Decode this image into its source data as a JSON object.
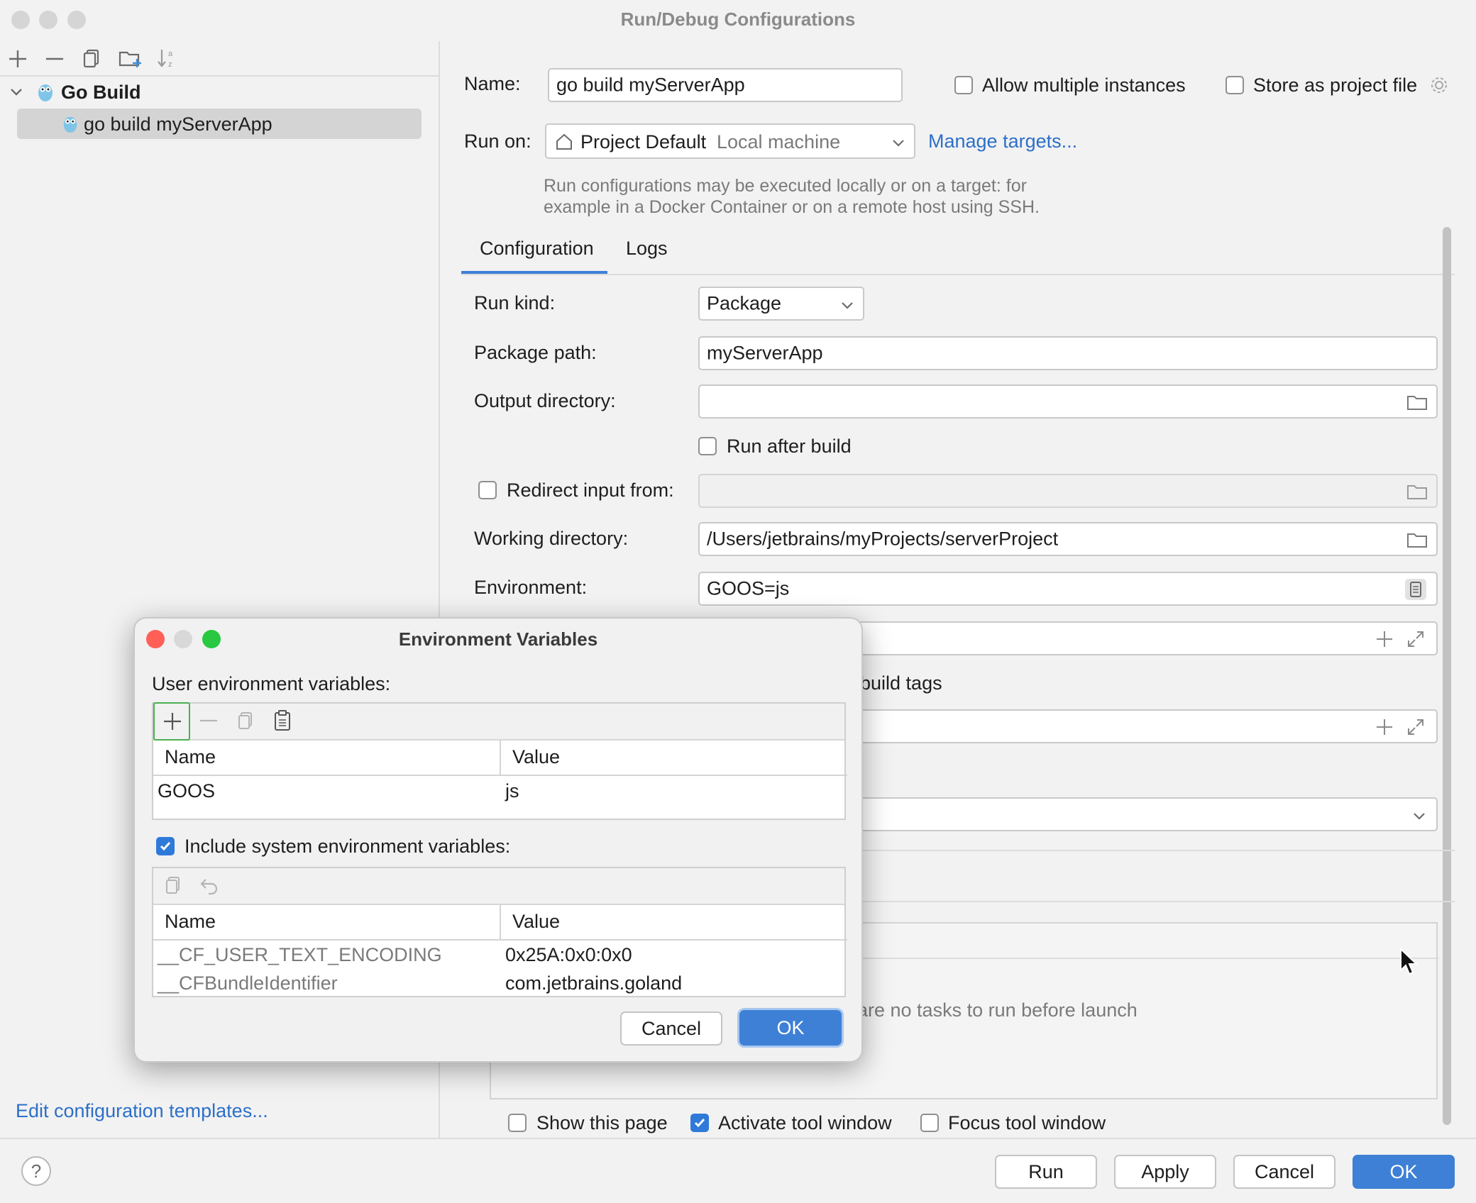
{
  "window": {
    "title": "Run/Debug Configurations"
  },
  "sidebar": {
    "tree": {
      "group_label": "Go Build",
      "item_label": "go build myServerApp"
    },
    "edit_templates_link": "Edit configuration templates..."
  },
  "form": {
    "name_label": "Name:",
    "name_value": "go build myServerApp",
    "allow_multiple_label": "Allow multiple instances",
    "store_project_label": "Store as project file",
    "run_on_label": "Run on:",
    "run_on_value": "Project Default",
    "run_on_hint": "Local machine",
    "manage_targets_link": "Manage targets...",
    "run_on_help_line1": "Run configurations may be executed locally or on a target: for",
    "run_on_help_line2": "example in a Docker Container or on a remote host using SSH.",
    "tabs": [
      {
        "label": "Configuration"
      },
      {
        "label": "Logs"
      }
    ],
    "run_kind_label": "Run kind:",
    "run_kind_value": "Package",
    "package_path_label": "Package path:",
    "package_path_value": "myServerApp",
    "output_dir_label": "Output directory:",
    "output_dir_value": "",
    "run_after_build_label": "Run after build",
    "redirect_input_label": "Redirect input from:",
    "working_dir_label": "Working directory:",
    "working_dir_value": "/Users/jetbrains/myProjects/serverProject",
    "environment_label": "Environment:",
    "environment_value": "GOOS=js",
    "build_tags_partial": "build tags",
    "before_launch_partial": "are no tasks to run before launch",
    "show_page_label": "Show this page",
    "activate_tool_label": "Activate tool window",
    "focus_tool_label": "Focus tool window"
  },
  "footer": {
    "run": "Run",
    "apply": "Apply",
    "cancel": "Cancel",
    "ok": "OK"
  },
  "env_dialog": {
    "title": "Environment Variables",
    "user_vars_label": "User environment variables:",
    "columns": [
      "Name",
      "Value"
    ],
    "user_rows": [
      {
        "name": "GOOS",
        "value": "js"
      }
    ],
    "include_system_label": "Include system environment variables:",
    "system_rows": [
      {
        "name": "__CF_USER_TEXT_ENCODING",
        "value": "0x25A:0x0:0x0"
      },
      {
        "name": "__CFBundleIdentifier",
        "value": "com.jetbrains.goland"
      }
    ],
    "cancel": "Cancel",
    "ok": "OK"
  }
}
